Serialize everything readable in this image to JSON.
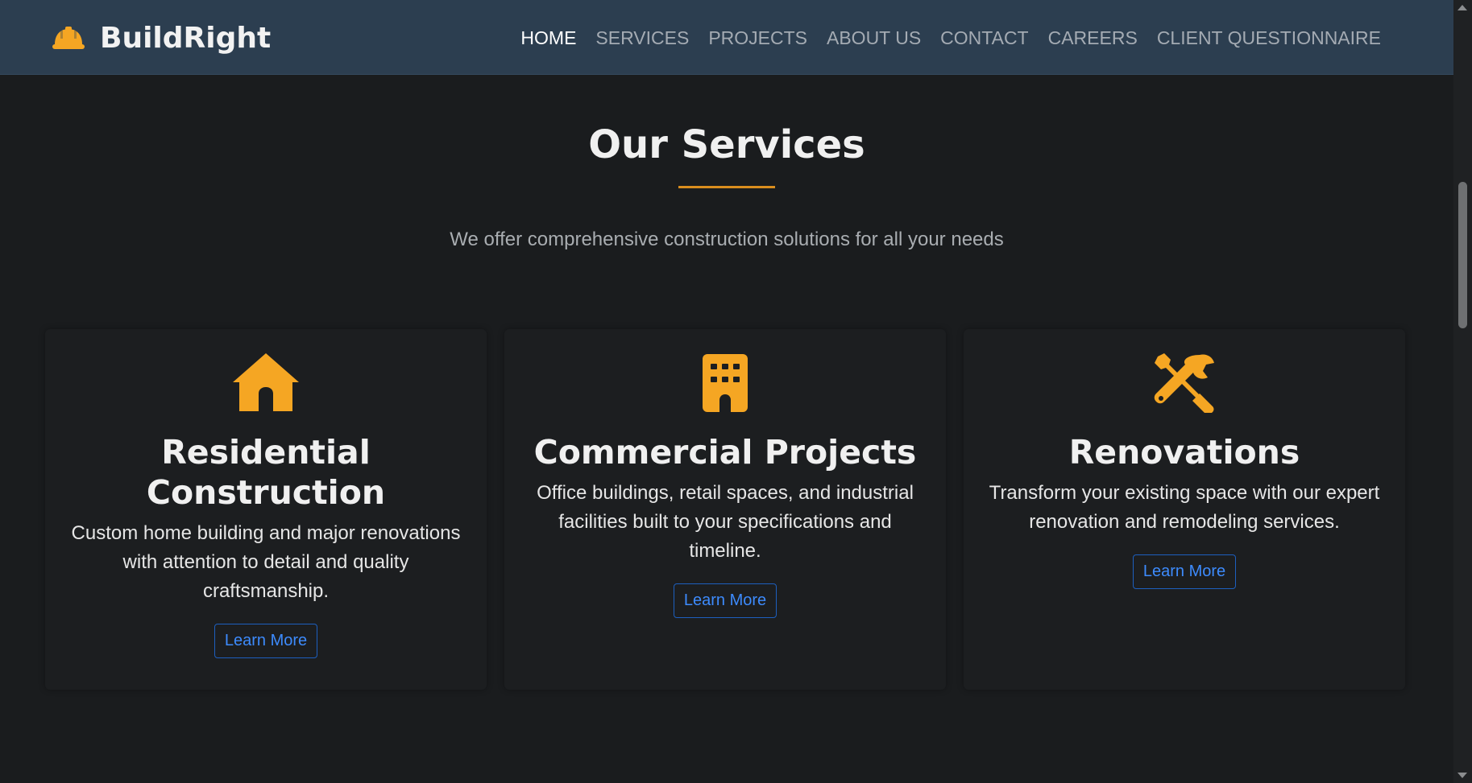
{
  "brand": {
    "name": "BuildRight",
    "icon": "hard-hat-icon",
    "accent_color": "#f5a623"
  },
  "nav": {
    "items": [
      {
        "label": "HOME",
        "active": true
      },
      {
        "label": "SERVICES",
        "active": false
      },
      {
        "label": "PROJECTS",
        "active": false
      },
      {
        "label": "ABOUT US",
        "active": false
      },
      {
        "label": "CONTACT",
        "active": false
      },
      {
        "label": "CAREERS",
        "active": false
      },
      {
        "label": "CLIENT QUESTIONNAIRE",
        "active": false
      }
    ]
  },
  "services": {
    "title": "Our Services",
    "subtitle": "We offer comprehensive construction solutions for all your needs",
    "cards": [
      {
        "icon": "house-icon",
        "title": "Residential Construction",
        "description": "Custom home building and major renovations with attention to detail and quality craftsmanship.",
        "button_label": "Learn More"
      },
      {
        "icon": "building-icon",
        "title": "Commercial Projects",
        "description": "Office buildings, retail spaces, and industrial facilities built to your specifications and timeline.",
        "button_label": "Learn More"
      },
      {
        "icon": "tools-icon",
        "title": "Renovations",
        "description": "Transform your existing space with our expert renovation and remodeling services.",
        "button_label": "Learn More"
      }
    ]
  },
  "colors": {
    "navbar_bg": "#2c3e50",
    "page_bg": "#1a1c1e",
    "accent": "#f5a623",
    "link_blue": "#3d8bfd"
  }
}
